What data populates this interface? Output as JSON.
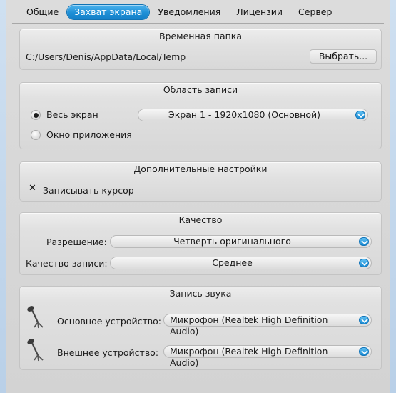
{
  "tabs": [
    {
      "label": "Общие",
      "active": false
    },
    {
      "label": "Захват экрана",
      "active": true
    },
    {
      "label": "Уведомления",
      "active": false
    },
    {
      "label": "Лицензии",
      "active": false
    },
    {
      "label": "Сервер",
      "active": false
    }
  ],
  "temp_folder": {
    "title": "Временная папка",
    "path": "C:/Users/Denis/AppData/Local/Temp",
    "browse_label": "Выбрать..."
  },
  "record_area": {
    "title": "Область записи",
    "full_screen_label": "Весь экран",
    "app_window_label": "Окно приложения",
    "full_screen_selected": true,
    "screen_value": "Экран 1 - 1920x1080 (Основной)"
  },
  "extra": {
    "title": "Дополнительные настройки",
    "record_cursor_label": "Записывать курсор",
    "record_cursor_mark": "✕"
  },
  "quality": {
    "title": "Качество",
    "resolution_label": "Разрешение:",
    "resolution_value": "Четверть оригинального",
    "record_quality_label": "Качество записи:",
    "record_quality_value": "Среднее"
  },
  "sound": {
    "title": "Запись звука",
    "main_device_label": "Основное устройство:",
    "main_device_value": "Микрофон (Realtek High Definition Audio)",
    "ext_device_label": "Внешнее устройство:",
    "ext_device_value": "Микрофон (Realtek High Definition Audio)"
  },
  "colors": {
    "accent": "#1e8fd6",
    "panel": "#dcdcdc"
  }
}
